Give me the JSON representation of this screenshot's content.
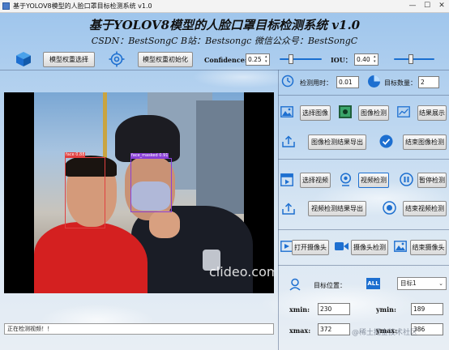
{
  "window": {
    "title": "基于YOLOV8模型的人脸口罩目标检测系统 v1.0",
    "controls": {
      "minimize": "—",
      "maximize": "☐",
      "close": "✕"
    }
  },
  "header": {
    "title": "基于YOLOV8模型的人脸口罩目标检测系统 v1.0",
    "subtitle": "CSDN：BestSongC   B站：Bestsongc   微信公众号：BestSongC"
  },
  "toolbar": {
    "weights_select_label": "模型权重选择",
    "weights_init_label": "模型权重初始化",
    "confidence_label": "Confidence:",
    "confidence_value": "0.25",
    "iou_label": "IOU：",
    "iou_value": "0.40"
  },
  "stats": {
    "time_label": "检测用时：",
    "time_value": "0.01",
    "count_label": "目标数量：",
    "count_value": "2"
  },
  "image_section": {
    "select_label": "选择图像",
    "detect_label": "图像检测",
    "show_label": "结果展示",
    "export_label": "图像检测结果导出",
    "end_label": "结束图像检测"
  },
  "video_section": {
    "select_label": "选择视频",
    "detect_label": "视频检测",
    "pause_label": "暂停检测",
    "export_label": "视频检测结果导出",
    "end_label": "结束视频检测"
  },
  "camera_section": {
    "open_label": "打开摄像头",
    "detect_label": "摄像头检测",
    "end_label": "结束摄像头"
  },
  "position": {
    "label": "目标位置：",
    "all_badge": "ALL",
    "target_selected": "目标1",
    "xmin_label": "xmin:",
    "xmin_value": "230",
    "ymin_label": "ymin:",
    "ymin_value": "189",
    "xmax_label": "xmax:",
    "xmax_value": "372",
    "ymax_label": "ymax:",
    "ymax_value": "386"
  },
  "detections": [
    {
      "label": "face 0.88",
      "color": "#e04040"
    },
    {
      "label": "face_masked 0.91",
      "color": "#8a3fd8"
    }
  ],
  "video_watermark": "clideo.com",
  "status_text": "正在检测视频！！",
  "corner_watermark": "@稀土掘金技术社区",
  "colors": {
    "slider_accent": "#1a6fd0",
    "icon_blue": "#1d6fd0"
  }
}
